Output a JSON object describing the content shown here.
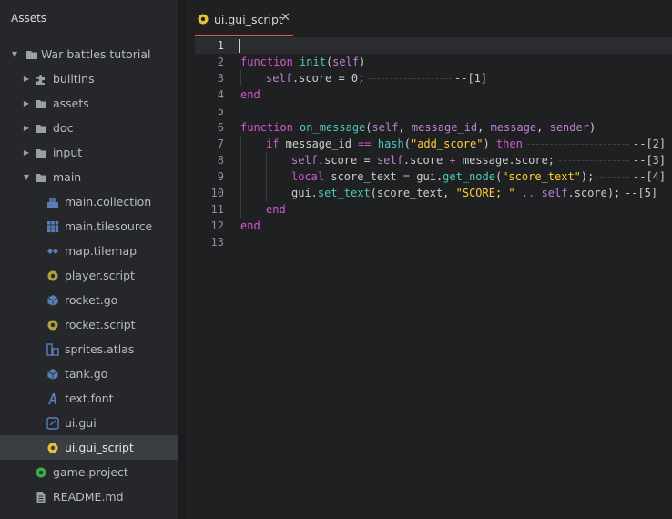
{
  "sidebar": {
    "title": "Assets",
    "items": [
      {
        "label": "War battles tutorial",
        "icon": "folder-icon",
        "arrow": "down"
      },
      {
        "label": "builtins",
        "icon": "puzzle-icon",
        "arrow": "right"
      },
      {
        "label": "assets",
        "icon": "folder-icon",
        "arrow": "right"
      },
      {
        "label": "doc",
        "icon": "folder-icon",
        "arrow": "right"
      },
      {
        "label": "input",
        "icon": "folder-icon",
        "arrow": "right"
      },
      {
        "label": "main",
        "icon": "folder-icon",
        "arrow": "down"
      },
      {
        "label": "main.collection",
        "icon": "collection-icon"
      },
      {
        "label": "main.tilesource",
        "icon": "tilesource-icon"
      },
      {
        "label": "map.tilemap",
        "icon": "tilemap-icon"
      },
      {
        "label": "player.script",
        "icon": "script-gear-icon"
      },
      {
        "label": "rocket.go",
        "icon": "cube-icon"
      },
      {
        "label": "rocket.script",
        "icon": "script-gear-icon"
      },
      {
        "label": "sprites.atlas",
        "icon": "atlas-icon"
      },
      {
        "label": "tank.go",
        "icon": "cube-icon"
      },
      {
        "label": "text.font",
        "icon": "font-icon"
      },
      {
        "label": "ui.gui",
        "icon": "gui-icon"
      },
      {
        "label": "ui.gui_script",
        "icon": "gui-script-icon",
        "selected": true
      },
      {
        "label": "game.project",
        "icon": "project-icon"
      },
      {
        "label": "README.md",
        "icon": "document-icon"
      }
    ]
  },
  "editor": {
    "tab": {
      "label": "ui.gui_script",
      "close": "✕",
      "icon": "gui-script-icon"
    },
    "lines": [
      {
        "n": "1",
        "html": ""
      },
      {
        "n": "2",
        "html": "function init(self)"
      },
      {
        "n": "3",
        "html": "self.score = 0;",
        "note": "--[1]"
      },
      {
        "n": "4",
        "html": "end"
      },
      {
        "n": "5",
        "html": ""
      },
      {
        "n": "6",
        "html": "function on_message(self, message_id, message, sender)"
      },
      {
        "n": "7",
        "html": "if message_id == hash(\"add_score\") then",
        "note": "--[2]"
      },
      {
        "n": "8",
        "html": "self.score = self.score + message.score;",
        "note": "--[3]"
      },
      {
        "n": "9",
        "html": "local score_text = gui.get_node(\"score_text\");",
        "note": "--[4]"
      },
      {
        "n": "10",
        "html": "gui.set_text(score_text, \"SCORE; \" .. self.score);",
        "note": "--[5]"
      },
      {
        "n": "11",
        "html": "end"
      },
      {
        "n": "12",
        "html": "end"
      },
      {
        "n": "13",
        "html": ""
      }
    ]
  },
  "colors": {
    "accent": "#e0613c",
    "keyword": "#d657d3",
    "function": "#4fc9b8",
    "param": "#c27fd9",
    "string": "#ffcc33"
  }
}
